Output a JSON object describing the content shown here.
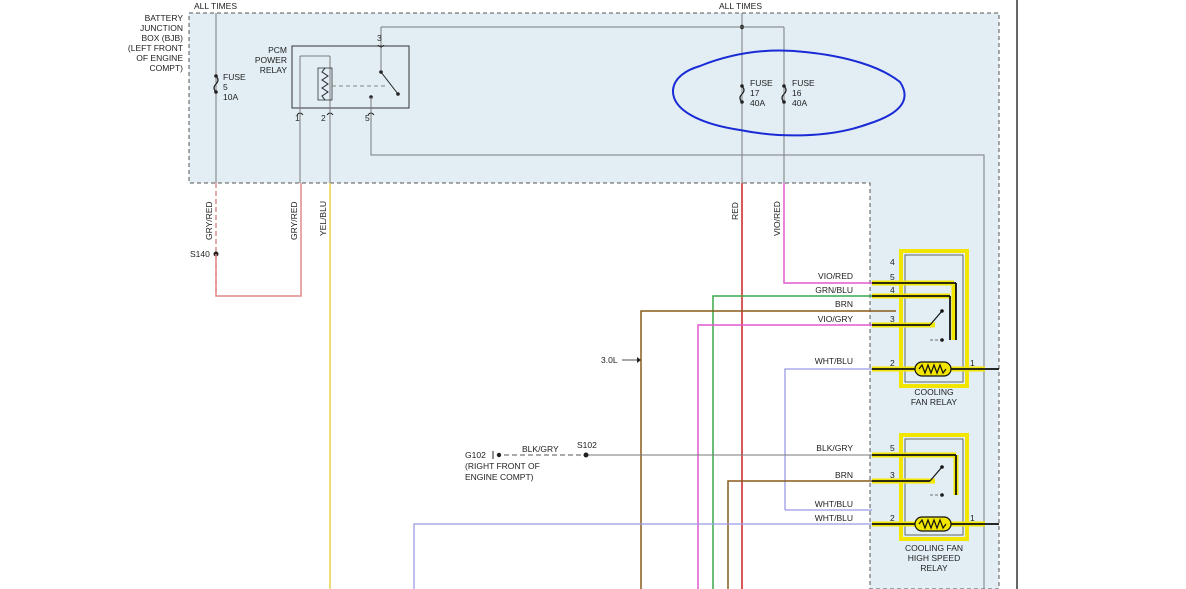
{
  "bjb": {
    "label_lines": [
      "BATTERY",
      "JUNCTION",
      "BOX (BJB)",
      "(LEFT FRONT",
      "OF ENGINE",
      "COMPT)"
    ],
    "all_times_left": "ALL TIMES",
    "all_times_right": "ALL TIMES"
  },
  "fuses": {
    "fuse5": [
      "FUSE",
      "5",
      "10A"
    ],
    "fuse17": [
      "FUSE",
      "17",
      "40A"
    ],
    "fuse16": [
      "FUSE",
      "16",
      "40A"
    ]
  },
  "pcm_relay": {
    "label_lines": [
      "PCM",
      "POWER",
      "RELAY"
    ],
    "pins": {
      "p1": "1",
      "p2": "2",
      "p3": "3",
      "p5": "5"
    }
  },
  "wires": {
    "gry_red_1": "GRY/RED",
    "gry_red_2": "GRY/RED",
    "yel_blu": "YEL/BLU",
    "red": "RED",
    "vio_red_vertical": "VIO/RED"
  },
  "splices": {
    "s140": "S140",
    "s102": "S102"
  },
  "ground": {
    "id": "G102",
    "line1": "(RIGHT FRONT OF",
    "line2": "ENGINE COMPT)",
    "wire": "BLK/GRY"
  },
  "engine_tag": "3.0L",
  "cooling_fan_relay": {
    "label_lines": [
      "COOLING",
      "FAN RELAY"
    ],
    "wires": {
      "w5": "VIO/RED",
      "w4": "GRN/BLU",
      "brn": "BRN",
      "w3": "VIO/GRY",
      "w2": "WHT/BLU"
    },
    "pins": {
      "p4top": "4",
      "p5": "5",
      "p4": "4",
      "p3": "3",
      "p2": "2",
      "p1": "1"
    }
  },
  "high_speed_relay": {
    "label_lines": [
      "COOLING FAN",
      "HIGH SPEED",
      "RELAY"
    ],
    "wires": {
      "w5": "BLK/GRY",
      "w3": "BRN",
      "wht_upper": "WHT/BLU",
      "w2": "WHT/BLU"
    },
    "pins": {
      "p5": "5",
      "p3": "3",
      "p2": "2",
      "p1": "1"
    }
  },
  "colors": {
    "junction_fill": "#e2eef4",
    "highlight": "#f2e600",
    "annotation": "#1a2bd6",
    "wire_red": "#cc2222",
    "wire_gry_red": "#e08a8a",
    "wire_yel": "#e8d24a",
    "wire_vio": "#e05ad0",
    "wire_grn": "#3aa84a",
    "wire_brn": "#8a5a1a",
    "wire_wht_blu": "#9a9ae6",
    "wire_gray": "#7a7a7a"
  }
}
